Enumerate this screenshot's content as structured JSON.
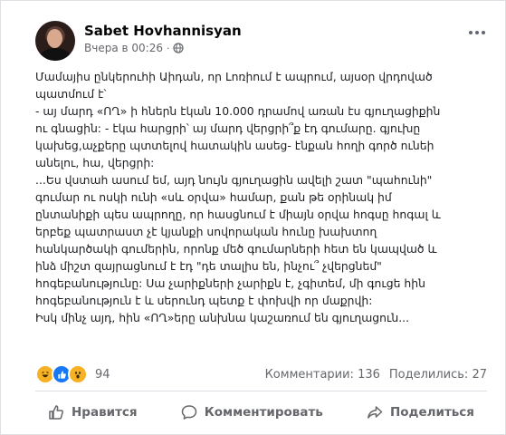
{
  "post": {
    "author": "Sabet Hovhannisyan",
    "time": "Вчера в 00:26",
    "separator": "·",
    "lines": [
      "Մամայիս ընկերուհի Աիդան, որ Լոռիում է ապրում, այսօր վրդոված",
      "պատմում է՝",
      "- այ մարդ «ՈՂ» ի հներն էկան 10.000 դրամով  առան  էս գյուղացիքին",
      "ու գնացին: - էկա հարցրի՝ այ մարդ վերցրի՞ք էդ գումարը. գյուխը",
      "կախեց,աչքերը պտտելով հատակին ասեց- էնքան հողի գործ ունեի",
      "անելու, հա, վերցրի:",
      "...Ես վստահ ասում եմ, այդ նույն գյուղացին ավելի շատ \"պահունի\"",
      "գումար ու ոսկի ունի «սև օրվա» համար, քան թե օրինակ իմ",
      "ընտանիքի պես ապրողը, որ հասցնում է միայն օրվա հոգսը հոգալ և",
      "երբեք պատրաստ չէ կյանքի սովորական հունը խախտող",
      "հանկարծակի գումերին, որոնք մեծ գումարների հետ են կապված և",
      "ինձ միշտ զայրացնում է էդ \"դե տալիս են, ինչու՞ չվերցնեմ\"",
      "հոգեբանությունը: Սա չարիքների չարիքն է, չգիտեմ, մի գուցե հին",
      "հոգեբանություն է և սերունդ պետք է փոխվի որ մաքրվի:",
      "Իսկ մինչ այդ, հին «ՈՂ»երը անխնա կաշառում են գյուղացուն..."
    ]
  },
  "stats": {
    "reactions_count": "94",
    "comments": "Комментарии: 136",
    "shares": "Поделились: 27"
  },
  "actions": {
    "like": "Нравится",
    "comment": "Комментировать",
    "share": "Поделиться"
  },
  "colors": {
    "like_blue": "#1877f2",
    "emoji_yellow": "#f7b125",
    "secondary_text": "#65676b"
  }
}
